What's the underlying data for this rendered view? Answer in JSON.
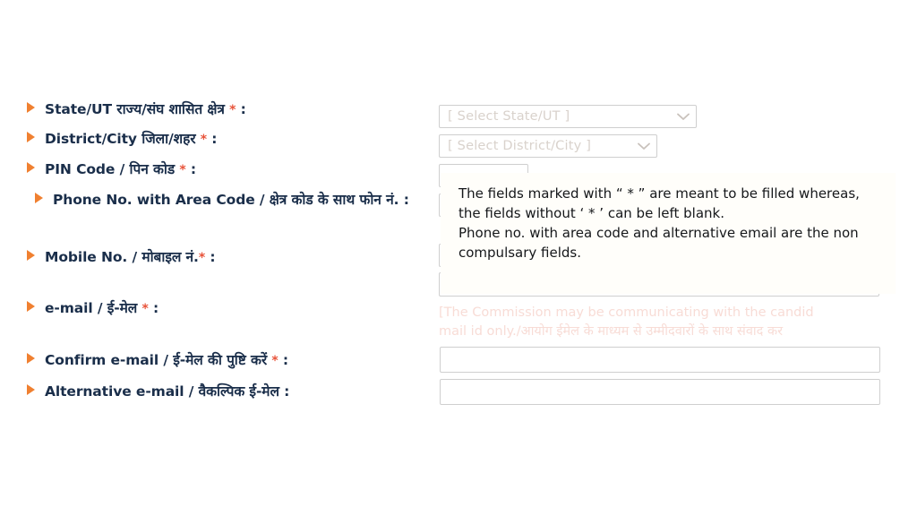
{
  "form": {
    "fields": [
      {
        "key": "state_ut",
        "label_en": "State/UT",
        "label_hi": "राज्य/संघ शासित क्षेत्र",
        "full_label": "State/UT राज्य/संघ शासित क्षेत्र",
        "required": true,
        "asterisk": "*",
        "colon": ":",
        "control": "select",
        "value": "[ Select State/UT ]"
      },
      {
        "key": "district_city",
        "label_en": "District/City",
        "label_hi": "जिला/शहर",
        "full_label": "District/City जिला/शहर",
        "required": true,
        "asterisk": "*",
        "colon": ":",
        "control": "select",
        "value": "[ Select District/City ]"
      },
      {
        "key": "pin_code",
        "label_en": "PIN Code",
        "label_hi": "पिन कोड",
        "full_label": "PIN Code / पिन कोड",
        "required": true,
        "asterisk": "*",
        "colon": ":",
        "control": "text",
        "value": ""
      },
      {
        "key": "phone_no",
        "label_en": "Phone No. with Area Code",
        "label_hi": "क्षेत्र कोड के साथ फोन नं.",
        "full_label": "Phone No. with Area Code / क्षेत्र कोड के साथ फोन नं.",
        "required": false,
        "asterisk": "",
        "colon": ":",
        "control": "text",
        "value": ""
      },
      {
        "key": "mobile_no",
        "label_en": "Mobile No.",
        "label_hi": "मोबाइल नं.",
        "full_label": "Mobile No. / मोबाइल नं.",
        "required": true,
        "asterisk": "*",
        "colon": ":",
        "control": "text",
        "value": ""
      },
      {
        "key": "email",
        "label_en": "e-mail",
        "label_hi": "ई-मेल",
        "full_label": "e-mail / ई-मेल",
        "required": true,
        "asterisk": "*",
        "colon": ":",
        "control": "text",
        "value": ""
      },
      {
        "key": "confirm_email",
        "label_en": "Confirm e-mail",
        "label_hi": "ई-मेल की पुष्टि करें",
        "full_label": "Confirm e-mail / ई-मेल की पुष्टि करें",
        "required": true,
        "asterisk": "*",
        "colon": ":",
        "control": "text",
        "value": ""
      },
      {
        "key": "alternative_email",
        "label_en": "Alternative e-mail",
        "label_hi": "वैकल्पिक ई-मेल",
        "full_label": "Alternative e-mail / वैकल्पिक ई-मेल",
        "required": false,
        "asterisk": "",
        "colon": ":",
        "control": "text",
        "value": ""
      }
    ]
  },
  "tooltip": {
    "line1": "The fields marked with “ * ” are meant to be filled whereas,",
    "line2": "the fields without ‘ * ’ can be left blank.",
    "line3": "Phone no. with area code and alternative email are the non compulsary fields."
  },
  "email_note": {
    "line1": "[The Commission may be communicating with the candid",
    "line2": "mail id only./आयोग ईमेल के माध्यम से उम्मीदवारों के साथ संवाद कर "
  },
  "icons": {
    "bullet": "triangle-right-bullet",
    "chevron": "chevron-down-icon"
  },
  "colors": {
    "bullet": "#f08030",
    "asterisk": "#e8533a",
    "label_text": "#1a2e4a",
    "placeholder": "#d9d2cc",
    "tooltip_bg": "#fffefa",
    "faded_note": "#f8dcd6",
    "field_border": "#cfcfcf"
  }
}
